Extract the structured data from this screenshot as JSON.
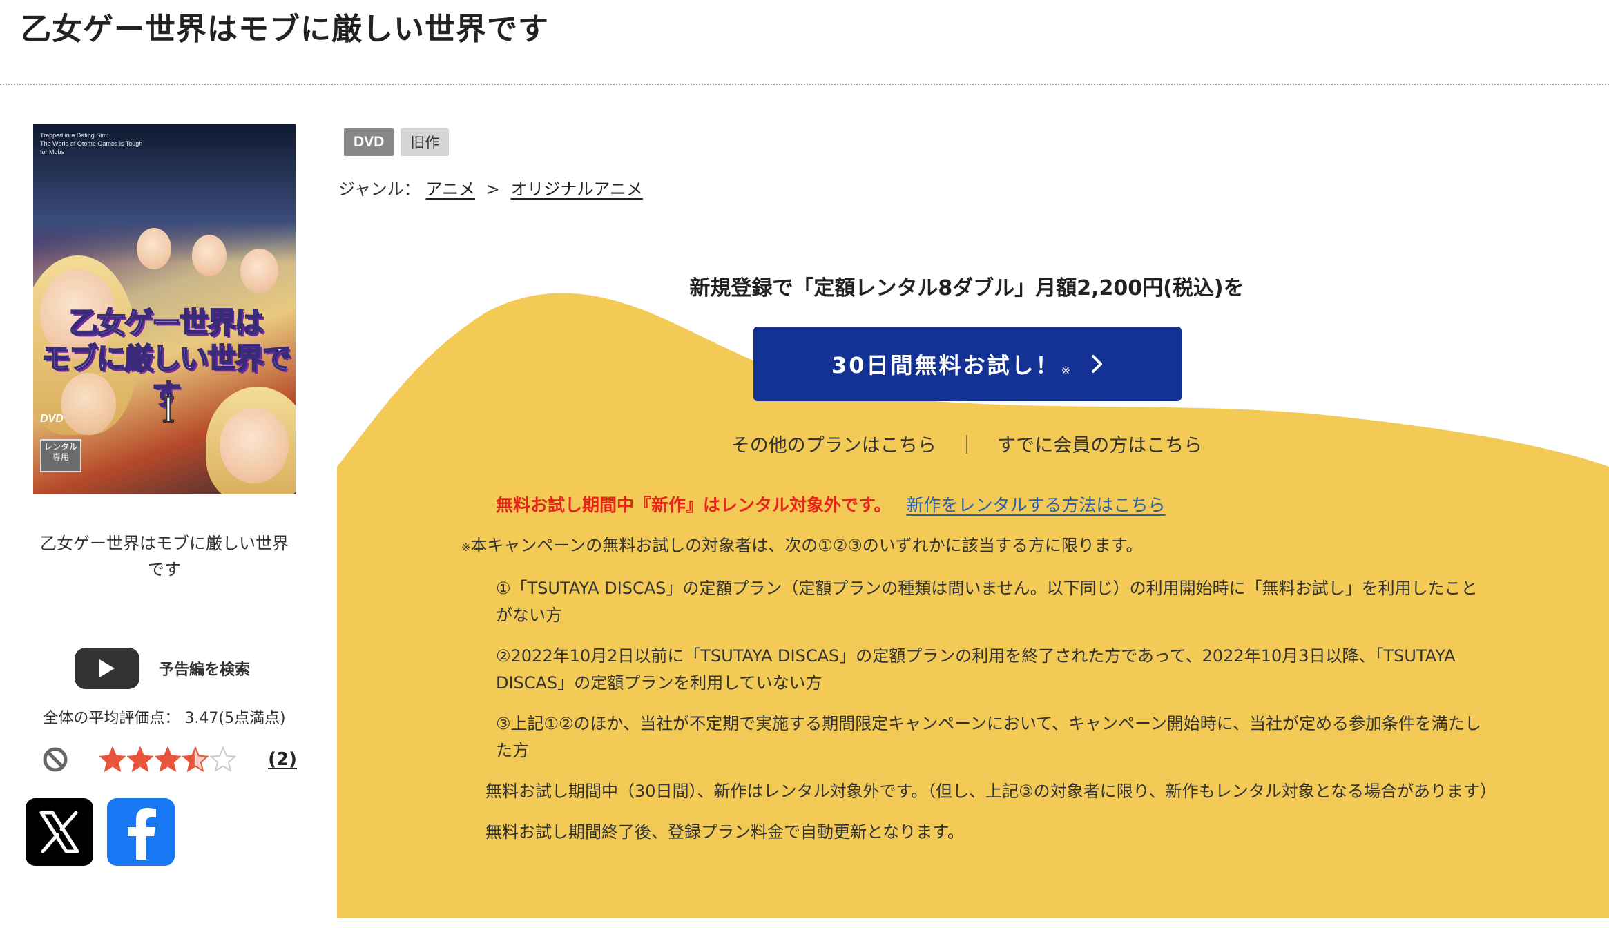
{
  "page": {
    "title": "乙女ゲー世界はモブに厳しい世界です"
  },
  "cover": {
    "small_text": [
      "Trapped in a Dating Sim:",
      "The World of Otome Games is Tough for Mobs"
    ],
    "title_line1": "乙女ゲー世界は",
    "title_line2": "モブに厳しい世界です",
    "volume": "I",
    "format_mark": "DVD",
    "rental_mark": "レンタル専用"
  },
  "item": {
    "name": "乙女ゲー世界はモブに厳しい世界です"
  },
  "trailer": {
    "label": "予告編を検索",
    "icon": "youtube-play-icon"
  },
  "rating": {
    "label": "全体の平均評価点： 3.47(5点満点)",
    "value": 3.47,
    "max": 5,
    "review_count_text": "(2)",
    "star_color": "#e8553c",
    "empty_star_color": "#cccccc"
  },
  "social": {
    "x_icon": "x-logo-icon",
    "facebook_icon": "facebook-logo-icon"
  },
  "badges": {
    "format": "DVD",
    "age": "旧作"
  },
  "genre": {
    "label": "ジャンル：",
    "items": [
      "アニメ",
      "オリジナルアニメ"
    ],
    "separator": ">"
  },
  "campaign": {
    "headline": "新規登録で「定額レンタル8ダブル」月額2,200円(税込)を",
    "trial_button": "30日間無料お試し！",
    "trial_mark": "※",
    "other_plans_link": "その他のプランはこちら",
    "divider": "｜",
    "member_link": "すでに会員の方はこちら",
    "notice_red": "無料お試し期間中『新作』はレンタル対象外です。",
    "notice_link": "新作をレンタルする方法はこちら",
    "accent_color": "#133294",
    "background_color": "#f2ca55",
    "terms": {
      "intro_mark": "※",
      "intro": "本キャンペーンの無料お試しの対象者は、次の①②③のいずれかに該当する方に限ります。",
      "conditions": [
        "①「TSUTAYA DISCAS」の定額プラン（定額プランの種類は問いません。以下同じ）の利用開始時に「無料お試し」を利用したことがない方",
        "②2022年10月2日以前に「TSUTAYA DISCAS」の定額プランの利用を終了された方であって、2022年10月3日以降、「TSUTAYA DISCAS」の定額プランを利用していない方",
        "③上記①②のほか、当社が不定期で実施する期間限定キャンペーンにおいて、キャンペーン開始時に、当社が定める参加条件を満たした方"
      ],
      "notes": [
        "無料お試し期間中（30日間）、新作はレンタル対象外です。（但し、上記③の対象者に限り、新作もレンタル対象となる場合があります）",
        "無料お試し期間終了後、登録プラン料金で自動更新となります。"
      ]
    }
  }
}
